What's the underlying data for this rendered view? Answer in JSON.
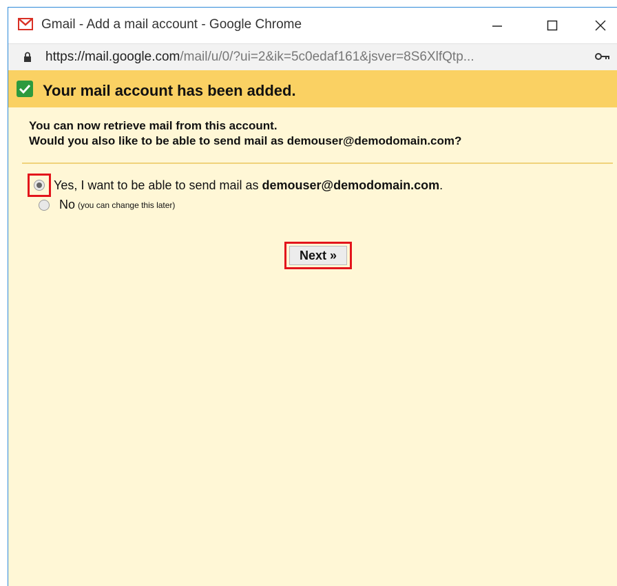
{
  "window": {
    "title": "Gmail - Add a mail account - Google Chrome"
  },
  "address": {
    "host": "https://mail.google.com",
    "path": "/mail/u/0/?ui=2&ik=5c0edaf161&jsver=8S6XlfQtp..."
  },
  "banner": {
    "title": "Your mail account has been added."
  },
  "intro": {
    "line1": "You can now retrieve mail from this account.",
    "line2": "Would you also like to be able to send mail as demouser@demodomain.com?"
  },
  "options": {
    "yes_prefix": "Yes, I want to be able to send mail as ",
    "yes_email": "demouser@demodomain.com",
    "yes_suffix": ".",
    "no_label": "No",
    "no_hint": "(you can change this later)",
    "selected": "yes"
  },
  "actions": {
    "next_label": "Next »"
  },
  "colors": {
    "banner": "#fad163",
    "content_bg": "#fff7d6",
    "highlight": "#e3141b",
    "check": "#2d9a3e"
  }
}
